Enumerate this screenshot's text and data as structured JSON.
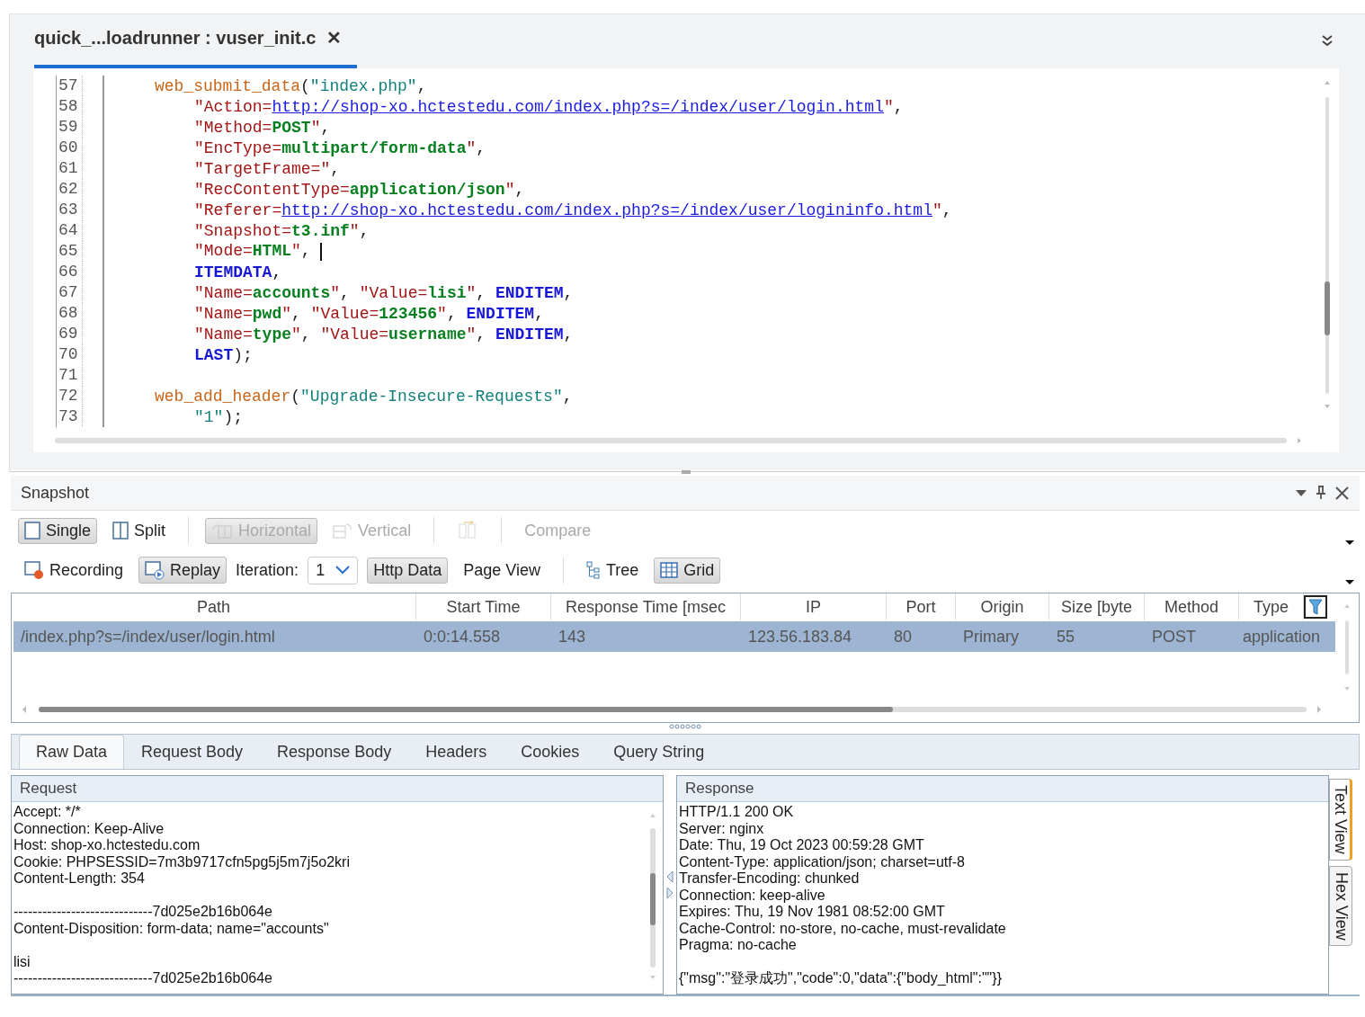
{
  "editor": {
    "tab": {
      "title": "quick_...loadrunner : vuser_init.c",
      "close": "✕",
      "selected": true
    },
    "lines": [
      {
        "number": "57",
        "kind": "call",
        "tokens": [
          {
            "kind": "fn",
            "text": "web_submit_data"
          },
          {
            "kind": "plain",
            "text": "("
          },
          {
            "kind": "str",
            "text": "\"index.php\""
          },
          {
            "kind": "plain",
            "text": ","
          }
        ]
      },
      {
        "number": "58",
        "kind": "arg",
        "tokens": [
          {
            "kind": "key",
            "text": "\"Action="
          },
          {
            "kind": "link",
            "text": "http://shop-xo.hctestedu.com/index.php?s=/index/user/login.html"
          },
          {
            "kind": "key",
            "text": "\""
          },
          {
            "kind": "plain",
            "text": ","
          }
        ]
      },
      {
        "number": "59",
        "kind": "arg",
        "tokens": [
          {
            "kind": "key",
            "text": "\"Method="
          },
          {
            "kind": "val",
            "text": "POST"
          },
          {
            "kind": "key",
            "text": "\""
          },
          {
            "kind": "plain",
            "text": ","
          }
        ]
      },
      {
        "number": "60",
        "kind": "arg",
        "tokens": [
          {
            "kind": "key",
            "text": "\"EncType="
          },
          {
            "kind": "val",
            "text": "multipart/form-data"
          },
          {
            "kind": "key",
            "text": "\""
          },
          {
            "kind": "plain",
            "text": ","
          }
        ]
      },
      {
        "number": "61",
        "kind": "arg",
        "tokens": [
          {
            "kind": "key",
            "text": "\"TargetFrame=\""
          },
          {
            "kind": "plain",
            "text": ","
          }
        ]
      },
      {
        "number": "62",
        "kind": "arg",
        "tokens": [
          {
            "kind": "key",
            "text": "\"RecContentType="
          },
          {
            "kind": "val",
            "text": "application/json"
          },
          {
            "kind": "key",
            "text": "\""
          },
          {
            "kind": "plain",
            "text": ","
          }
        ]
      },
      {
        "number": "63",
        "kind": "arg",
        "tokens": [
          {
            "kind": "key",
            "text": "\"Referer="
          },
          {
            "kind": "link",
            "text": "http://shop-xo.hctestedu.com/index.php?s=/index/user/logininfo.html"
          },
          {
            "kind": "key",
            "text": "\""
          },
          {
            "kind": "plain",
            "text": ","
          }
        ]
      },
      {
        "number": "64",
        "kind": "arg",
        "tokens": [
          {
            "kind": "key",
            "text": "\"Snapshot="
          },
          {
            "kind": "val",
            "text": "t3.inf"
          },
          {
            "kind": "key",
            "text": "\""
          },
          {
            "kind": "plain",
            "text": ","
          }
        ]
      },
      {
        "number": "65",
        "kind": "arg",
        "tokens": [
          {
            "kind": "key",
            "text": "\"Mode="
          },
          {
            "kind": "val",
            "text": "HTML"
          },
          {
            "kind": "key",
            "text": "\""
          },
          {
            "kind": "plain",
            "text": ", "
          },
          {
            "kind": "cursor"
          }
        ]
      },
      {
        "number": "66",
        "kind": "arg",
        "tokens": [
          {
            "kind": "kw",
            "text": "ITEMDATA"
          },
          {
            "kind": "plain",
            "text": ","
          }
        ]
      },
      {
        "number": "67",
        "kind": "arg",
        "tokens": [
          {
            "kind": "key",
            "text": "\"Name="
          },
          {
            "kind": "val",
            "text": "accounts"
          },
          {
            "kind": "key",
            "text": "\""
          },
          {
            "kind": "plain",
            "text": ", "
          },
          {
            "kind": "key",
            "text": "\"Value="
          },
          {
            "kind": "val",
            "text": "lisi"
          },
          {
            "kind": "key",
            "text": "\""
          },
          {
            "kind": "plain",
            "text": ", "
          },
          {
            "kind": "kw",
            "text": "ENDITEM"
          },
          {
            "kind": "plain",
            "text": ","
          }
        ]
      },
      {
        "number": "68",
        "kind": "arg",
        "tokens": [
          {
            "kind": "key",
            "text": "\"Name="
          },
          {
            "kind": "val",
            "text": "pwd"
          },
          {
            "kind": "key",
            "text": "\""
          },
          {
            "kind": "plain",
            "text": ", "
          },
          {
            "kind": "key",
            "text": "\"Value="
          },
          {
            "kind": "val",
            "text": "123456"
          },
          {
            "kind": "key",
            "text": "\""
          },
          {
            "kind": "plain",
            "text": ", "
          },
          {
            "kind": "kw",
            "text": "ENDITEM"
          },
          {
            "kind": "plain",
            "text": ","
          }
        ]
      },
      {
        "number": "69",
        "kind": "arg",
        "tokens": [
          {
            "kind": "key",
            "text": "\"Name="
          },
          {
            "kind": "val",
            "text": "type"
          },
          {
            "kind": "key",
            "text": "\""
          },
          {
            "kind": "plain",
            "text": ", "
          },
          {
            "kind": "key",
            "text": "\"Value="
          },
          {
            "kind": "val",
            "text": "username"
          },
          {
            "kind": "key",
            "text": "\""
          },
          {
            "kind": "plain",
            "text": ", "
          },
          {
            "kind": "kw",
            "text": "ENDITEM"
          },
          {
            "kind": "plain",
            "text": ","
          }
        ]
      },
      {
        "number": "70",
        "kind": "arg",
        "tokens": [
          {
            "kind": "kw",
            "text": "LAST"
          },
          {
            "kind": "plain",
            "text": ");"
          }
        ]
      },
      {
        "number": "71",
        "kind": "blank"
      },
      {
        "number": "72",
        "kind": "call",
        "tokens": [
          {
            "kind": "fn",
            "text": "web_add_header"
          },
          {
            "kind": "plain",
            "text": "("
          },
          {
            "kind": "str",
            "text": "\"Upgrade-Insecure-Requests\""
          },
          {
            "kind": "plain",
            "text": ","
          }
        ]
      },
      {
        "number": "73",
        "kind": "arg",
        "tokens": [
          {
            "kind": "str",
            "text": "\"1\""
          },
          {
            "kind": "plain",
            "text": ");"
          }
        ]
      }
    ]
  },
  "snapshot": {
    "title": "Snapshot",
    "toolbar_1": [
      {
        "kind": "button",
        "label": "Single",
        "selected": true,
        "disabled": false
      },
      {
        "kind": "button",
        "label": "Split",
        "selected": false,
        "disabled": false
      },
      {
        "kind": "separator"
      },
      {
        "kind": "button",
        "label": "Horizontal",
        "selected": true,
        "disabled": true
      },
      {
        "kind": "button",
        "label": "Vertical",
        "selected": false,
        "disabled": true
      },
      {
        "kind": "separator"
      },
      {
        "kind": "button",
        "selected": false,
        "disabled": true
      },
      {
        "kind": "separator"
      },
      {
        "kind": "button",
        "label": "Compare",
        "selected": false,
        "disabled": true
      }
    ],
    "toolbar_2": [
      {
        "kind": "button",
        "label": "Recording",
        "selected": false,
        "disabled": false
      },
      {
        "kind": "button",
        "label": "Replay",
        "selected": true,
        "disabled": false
      },
      {
        "kind": "label",
        "label": "Iteration:"
      },
      {
        "kind": "dropdown",
        "value": "1"
      },
      {
        "kind": "button",
        "label": "Http Data",
        "selected": true,
        "disabled": false
      },
      {
        "kind": "button",
        "label": "Page View",
        "selected": false,
        "disabled": false
      },
      {
        "kind": "separator"
      },
      {
        "kind": "button",
        "label": "Tree",
        "selected": false,
        "disabled": false
      },
      {
        "kind": "button",
        "label": "Grid",
        "selected": true,
        "disabled": false
      }
    ],
    "table": {
      "columns": [
        "Path",
        "Start Time",
        "Response Time [msec",
        "IP",
        "Port",
        "Origin",
        "Size [byte",
        "Method",
        "Type"
      ],
      "rows": [
        {
          "selected": true,
          "cells": [
            "/index.php?s=/index/user/login.html",
            "0:0:14.558",
            "143",
            "123.56.183.84",
            "80",
            "Primary",
            "55",
            "POST",
            "application"
          ]
        }
      ]
    },
    "tabs": [
      {
        "label": "Raw Data",
        "selected": true
      },
      {
        "label": "Request Body",
        "selected": false
      },
      {
        "label": "Response Body",
        "selected": false
      },
      {
        "label": "Headers",
        "selected": false
      },
      {
        "label": "Cookies",
        "selected": false
      },
      {
        "label": "Query String",
        "selected": false
      }
    ],
    "request": {
      "title": "Request",
      "blocks": [
        [
          "Accept: */*",
          "Connection: Keep-Alive",
          "Host: shop-xo.hctestedu.com",
          "Cookie: PHPSESSID=7m3b9717cfn5pg5j5m7j5o2kri",
          "Content-Length: 354"
        ],
        [
          "-----------------------------7d025e2b16b064e",
          "Content-Disposition: form-data; name=\"accounts\""
        ],
        [
          "lisi",
          "-----------------------------7d025e2b16b064e"
        ]
      ]
    },
    "response": {
      "title": "Response",
      "blocks": [
        [
          "HTTP/1.1 200 OK",
          "Server: nginx",
          "Date: Thu, 19 Oct 2023 00:59:28 GMT",
          "Content-Type: application/json; charset=utf-8",
          "Transfer-Encoding: chunked",
          "Connection: keep-alive",
          "Expires: Thu, 19 Nov 1981 08:52:00 GMT",
          "Cache-Control: no-store, no-cache, must-revalidate",
          "Pragma: no-cache"
        ],
        [
          "{\"msg\":\"登录成功\",\"code\":0,\"data\":{\"body_html\":\"\"}}"
        ]
      ]
    },
    "view_tabs": [
      {
        "label": "Text View",
        "selected": true
      },
      {
        "label": "Hex View",
        "selected": false
      }
    ]
  }
}
